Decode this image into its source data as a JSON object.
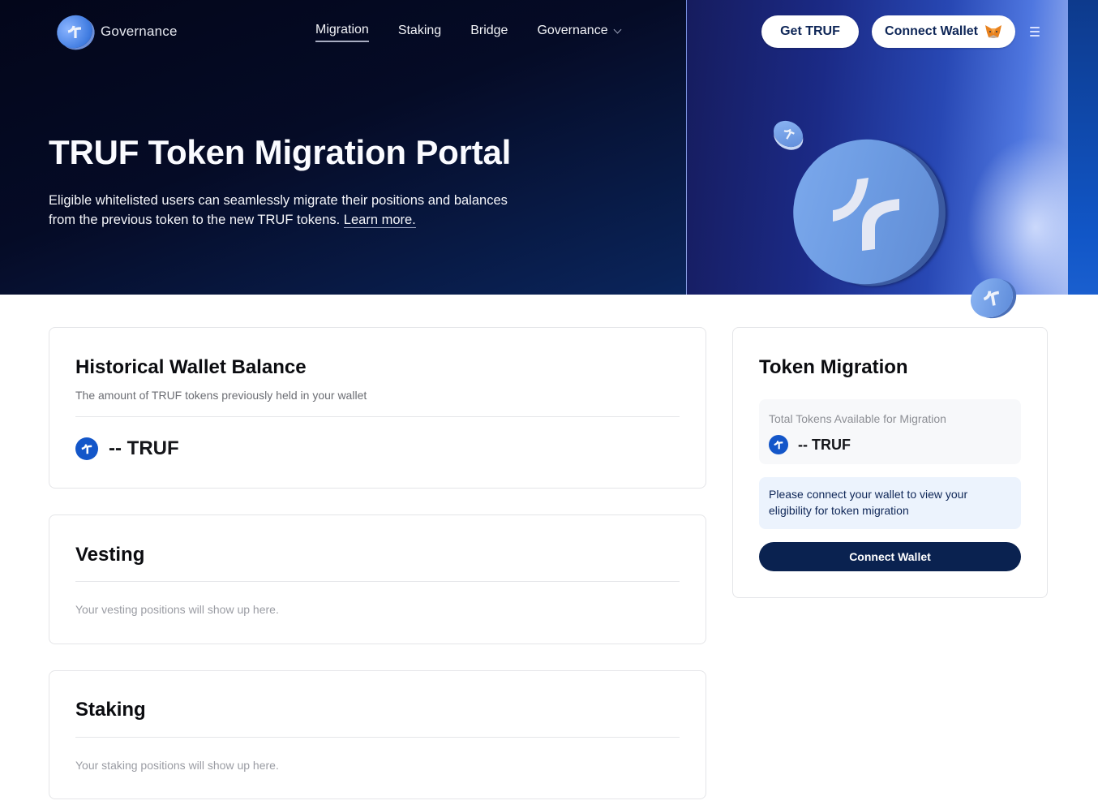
{
  "nav": {
    "brand": "Governance",
    "links": [
      {
        "label": "Migration",
        "active": true
      },
      {
        "label": "Staking",
        "active": false
      },
      {
        "label": "Bridge",
        "active": false
      },
      {
        "label": "Governance",
        "active": false,
        "has_dropdown": true
      }
    ],
    "get_truf_label": "Get TRUF",
    "connect_wallet_label": "Connect Wallet",
    "wallet_icon": "metamask-fox-icon",
    "menu_icon": "hamburger-menu-icon"
  },
  "hero": {
    "title": "TRUF Token Migration Portal",
    "description": "Eligible whitelisted users can seamlessly migrate their positions and balances from the previous token to the new TRUF tokens.",
    "learn_more": "Learn more."
  },
  "historical": {
    "title": "Historical Wallet Balance",
    "subtitle": "The amount of TRUF tokens previously held in your wallet",
    "balance": "-- TRUF"
  },
  "vesting": {
    "title": "Vesting",
    "empty": "Your vesting positions will show up here."
  },
  "staking": {
    "title": "Staking",
    "empty": "Your staking positions will show up here."
  },
  "migration": {
    "title": "Token Migration",
    "total_label": "Total Tokens Available for Migration",
    "total_value": "-- TRUF",
    "notice": "Please connect your wallet to view your eligibility for token migration",
    "button": "Connect Wallet"
  },
  "colors": {
    "brand_blue": "#1356c9",
    "navy": "#0a2250",
    "notice_bg": "#ecf3fd"
  }
}
